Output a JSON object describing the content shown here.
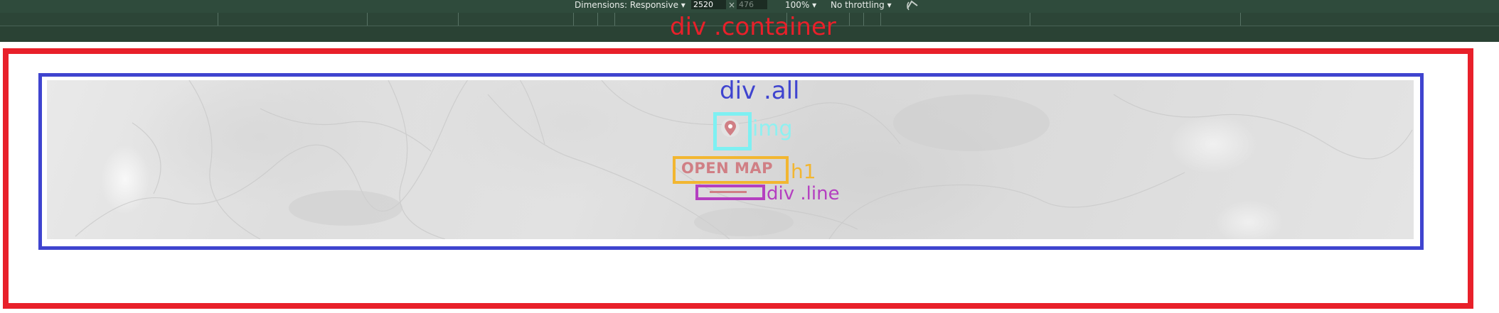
{
  "devtools": {
    "dimensions_label": "Dimensions: Responsive ▾",
    "width_value": "2520",
    "times": "×",
    "height_value": "476",
    "zoom": "100% ▾",
    "throttling": "No throttling ▾",
    "rotate_icon": "rotate-icon"
  },
  "overlays": {
    "container_label": "div .container",
    "all_label": "div .all",
    "img_label": "img",
    "h1_label": "h1",
    "line_label": "div .line"
  },
  "hero": {
    "heading": "OPEN MAP",
    "icon": "map-pin-icon"
  },
  "colors": {
    "container_outline": "#e8202a",
    "all_outline": "#3f44cf",
    "img_outline": "#7ef0f2",
    "h1_outline": "#f2b631",
    "line_outline": "#b43fc0",
    "accent_pink": "#d07f85"
  }
}
